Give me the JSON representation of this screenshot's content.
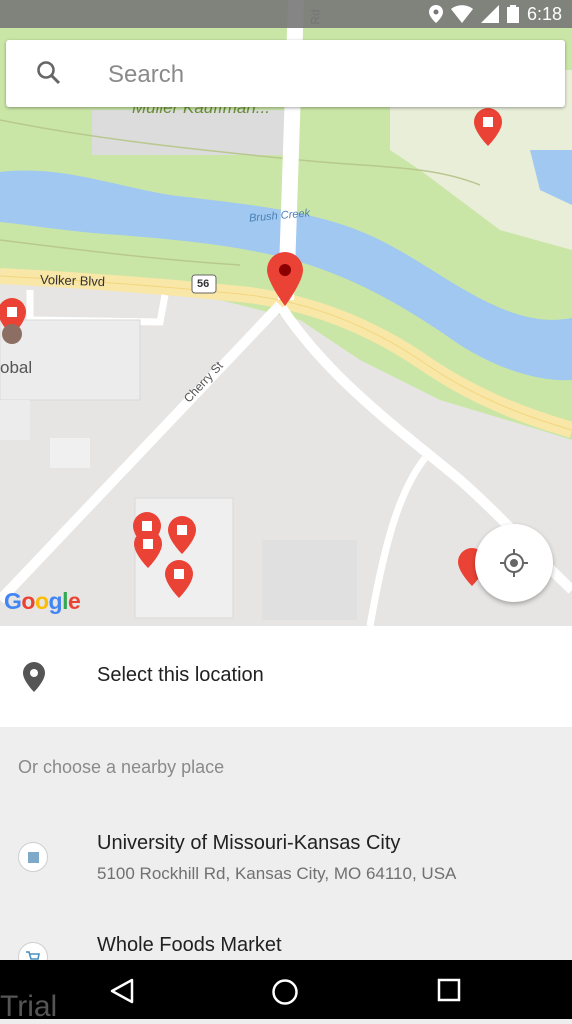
{
  "status_bar": {
    "time": "6:18"
  },
  "search": {
    "placeholder": "Search"
  },
  "map": {
    "street_labels": {
      "volker": "Volker Blvd",
      "cherry": "Cherry St",
      "creek": "Brush Creek",
      "route": "56",
      "top_road": "Rd",
      "top_label": "Muller Kauffman...",
      "left_partial": "obal"
    },
    "attribution": "Google",
    "colors": {
      "water": "#a0c8f0",
      "park": "#cae6a6",
      "road": "#ffffff",
      "major_road": "#f9e7a8",
      "pin": "#ea4335"
    }
  },
  "select_location": {
    "label": "Select this location",
    "icon": "place-pin-icon"
  },
  "nearby": {
    "header": "Or choose a nearby place",
    "places": [
      {
        "name": "University of Missouri-Kansas City",
        "address": "5100 Rockhill Rd, Kansas City, MO 64110, USA",
        "icon": "university-icon"
      },
      {
        "name": "Whole Foods Market",
        "address": "",
        "icon": "shopping-cart-icon"
      }
    ]
  },
  "navigation": {
    "back": "back-icon",
    "home": "home-icon",
    "recents": "recents-icon"
  },
  "watermark": "Trial"
}
